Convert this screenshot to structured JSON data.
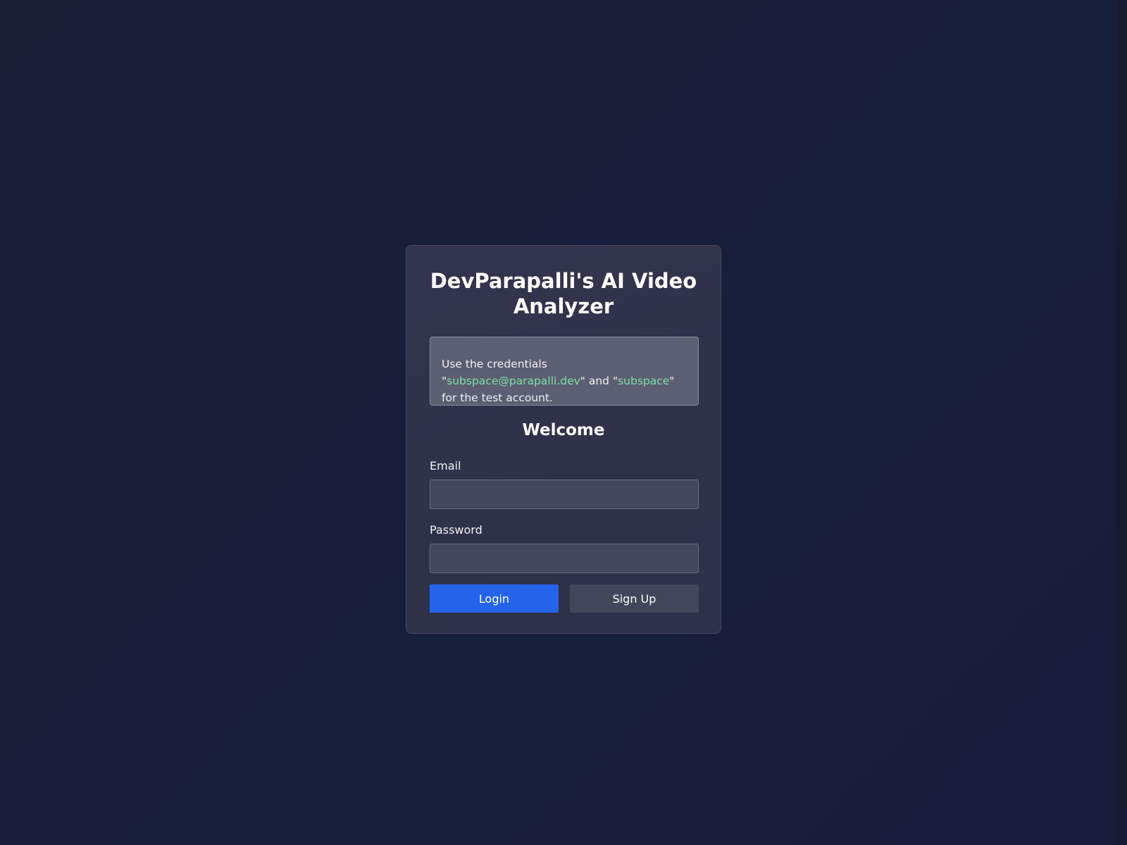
{
  "card": {
    "title": "DevParapalli's AI Video Analyzer",
    "notice": {
      "prefix": "Use the credentials \"",
      "email": "subspace@parapalli.dev",
      "middle": "\" and \"",
      "password": "subspace",
      "suffix": "\" for the test account."
    },
    "heading": "Welcome",
    "email_label": "Email",
    "email_value": "",
    "password_label": "Password",
    "password_value": "",
    "login_label": "Login",
    "signup_label": "Sign Up"
  },
  "colors": {
    "accent": "#2563eb",
    "highlight": "#7be0a6",
    "background": "#1b1d35"
  }
}
